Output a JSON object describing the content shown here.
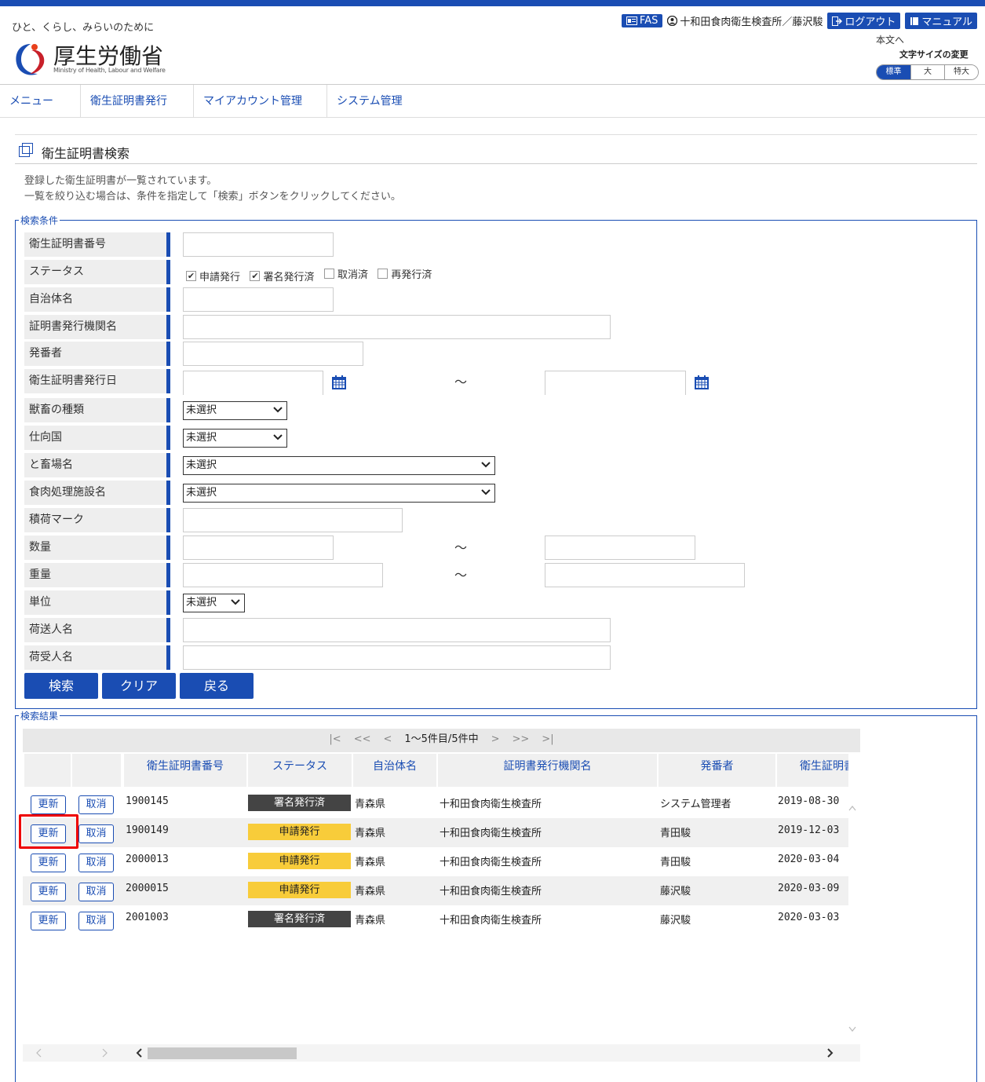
{
  "header": {
    "slogan": "ひと、くらし、みらいのために",
    "logo_name": "厚生労働省",
    "logo_en": "Ministry of Health, Labour and Welfare",
    "fas_label": "FAS",
    "user_label": "十和田食肉衛生検査所／藤沢駿",
    "logout_label": "ログアウト",
    "manual_label": "マニュアル",
    "skip_link": "本文へ",
    "fontsize_label": "文字サイズの変更",
    "fontsize_options": [
      "標準",
      "大",
      "特大"
    ]
  },
  "nav": {
    "items": [
      "メニュー",
      "衛生証明書発行",
      "マイアカウント管理",
      "システム管理"
    ]
  },
  "page": {
    "title": "衛生証明書検索",
    "desc_line1": "登録した衛生証明書が一覧されています。",
    "desc_line2": "一覧を絞り込む場合は、条件を指定して「検索」ボタンをクリックしてください。"
  },
  "search": {
    "legend": "検索条件",
    "labels": [
      "衛生証明書番号",
      "ステータス",
      "自治体名",
      "証明書発行機関名",
      "発番者",
      "衛生証明書発行日",
      "獣畜の種類",
      "仕向国",
      "と畜場名",
      "食肉処理施設名",
      "積荷マーク",
      "数量",
      "重量",
      "単位",
      "荷送人名",
      "荷受人名"
    ],
    "status_options": [
      {
        "label": "申請発行",
        "checked": "✔"
      },
      {
        "label": "署名発行済",
        "checked": "✔"
      },
      {
        "label": "取消済",
        "checked": ""
      },
      {
        "label": "再発行済",
        "checked": ""
      }
    ],
    "select_default": "未選択",
    "tilde": "～",
    "buttons": {
      "search": "検索",
      "clear": "クリア",
      "back": "戻る"
    }
  },
  "results": {
    "legend": "検索結果",
    "pager": {
      "first": "|<",
      "prev2": "<<",
      "prev": "<",
      "info": "1～5件目/5件中",
      "next": ">",
      "next2": ">>",
      "last": ">|"
    },
    "columns": [
      "衛生証明書番号",
      "ステータス",
      "自治体名",
      "証明書発行機関名",
      "発番者",
      "衛生証明書"
    ],
    "update_label": "更新",
    "cancel_label": "取消",
    "rows": [
      {
        "number": "1900145",
        "status": "署名発行済",
        "status_style": "dark",
        "municipality": "青森県",
        "issuer": "十和田食肉衛生検査所",
        "numberer": "システム管理者",
        "date": "2019-08-30"
      },
      {
        "number": "1900149",
        "status": "申請発行",
        "status_style": "yellow",
        "municipality": "青森県",
        "issuer": "十和田食肉衛生検査所",
        "numberer": "青田駿",
        "date": "2019-12-03"
      },
      {
        "number": "2000013",
        "status": "申請発行",
        "status_style": "yellow",
        "municipality": "青森県",
        "issuer": "十和田食肉衛生検査所",
        "numberer": "青田駿",
        "date": "2020-03-04"
      },
      {
        "number": "2000015",
        "status": "申請発行",
        "status_style": "yellow",
        "municipality": "青森県",
        "issuer": "十和田食肉衛生検査所",
        "numberer": "藤沢駿",
        "date": "2020-03-09"
      },
      {
        "number": "2001003",
        "status": "署名発行済",
        "status_style": "dark",
        "municipality": "青森県",
        "issuer": "十和田食肉衛生検査所",
        "numberer": "藤沢駿",
        "date": "2020-03-03"
      }
    ]
  },
  "colors": {
    "accent": "#1a4db3",
    "yellow_badge": "#f8cc3a",
    "dark_badge": "#444444",
    "highlight": "#e00000"
  }
}
